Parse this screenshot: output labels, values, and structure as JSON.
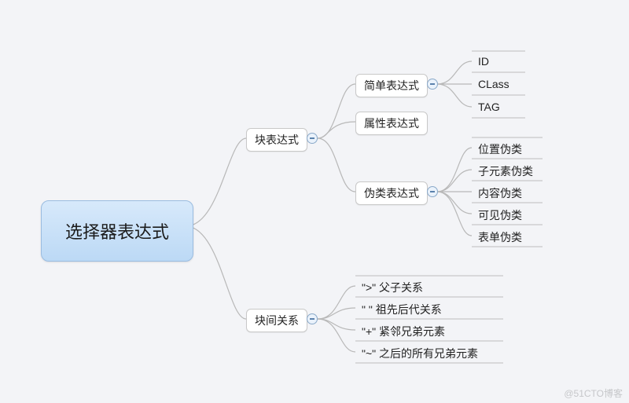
{
  "root": {
    "label": "选择器表达式"
  },
  "level1": {
    "block_expr": "块表达式",
    "block_relation": "块间关系"
  },
  "block_expr_children": {
    "simple": "简单表达式",
    "attr": "属性表达式",
    "pseudo": "伪类表达式"
  },
  "simple_leaves": {
    "id": "ID",
    "class": "CLass",
    "tag": "TAG"
  },
  "pseudo_leaves": {
    "position": "位置伪类",
    "child": "子元素伪类",
    "content": "内容伪类",
    "visible": "可见伪类",
    "form": "表单伪类"
  },
  "relation_leaves": {
    "parent_child": "\">\" 父子关系",
    "ancestor": "\" \" 祖先后代关系",
    "adjacent": "\"+\" 紧邻兄弟元素",
    "siblings": "\"~\" 之后的所有兄弟元素"
  },
  "watermark": "@51CTO博客"
}
